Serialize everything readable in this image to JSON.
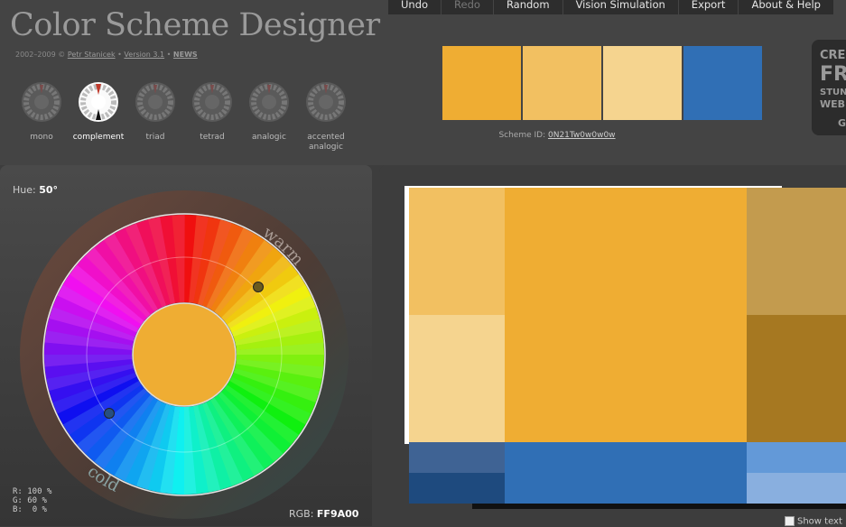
{
  "app": {
    "title": "Color Scheme Designer",
    "subtitle_years": "2002–2009 ©",
    "author": "Petr Stanicek",
    "version": "Version 3.1",
    "news": "NEWS"
  },
  "menu": [
    {
      "label": "Undo",
      "enabled": true
    },
    {
      "label": "Redo",
      "enabled": false
    },
    {
      "label": "Random",
      "enabled": true
    },
    {
      "label": "Vision Simulation",
      "enabled": true
    },
    {
      "label": "Export",
      "enabled": true
    },
    {
      "label": "About & Help",
      "enabled": true
    }
  ],
  "modes": [
    {
      "label": "mono",
      "active": false
    },
    {
      "label": "complement",
      "active": true
    },
    {
      "label": "triad",
      "active": false
    },
    {
      "label": "tetrad",
      "active": false
    },
    {
      "label": "analogic",
      "active": false
    },
    {
      "label": "accented analogic",
      "active": false
    }
  ],
  "scheme": {
    "swatch_colors": [
      "#EFAD33",
      "#F2C061",
      "#F5D48F",
      "#306FB5"
    ],
    "scheme_id_label": "Scheme ID:",
    "scheme_id": "0N21Tw0w0w0w"
  },
  "ad": {
    "lines": [
      "CRE",
      "FR",
      "STUN",
      "WEB",
      "G"
    ]
  },
  "wheel": {
    "hue_label": "Hue:",
    "hue_value": "50°",
    "warm_label": "warm",
    "cold_label": "cold",
    "center_color": "#EFAD33",
    "rgb": {
      "r_label": "R:",
      "r": "100 %",
      "g_label": "G:",
      "g": "60 %",
      "b_label": "B:",
      "b": "0 %"
    },
    "rgb_hex_label": "RGB:",
    "rgb_hex": "FF9A00"
  },
  "preview": {
    "colors": {
      "primary": "#EFAD33",
      "primary_light": "#F2C061",
      "primary_lighter": "#F5D48F",
      "primary_dark": "#C39B4E",
      "primary_darker": "#A67821",
      "comp": "#306FB5",
      "comp_dark": "#3F6394",
      "comp_darker": "#1E4A7E",
      "comp_light": "#6399D8",
      "comp_lighter": "#89AFDF"
    },
    "show_text_label": "Show text"
  }
}
